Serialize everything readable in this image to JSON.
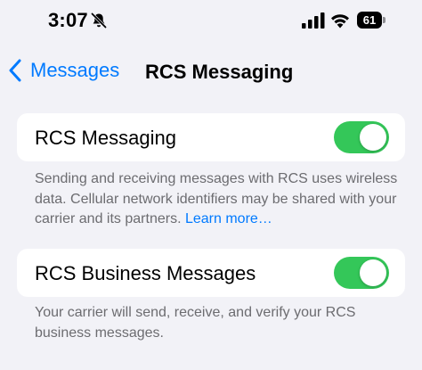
{
  "status_bar": {
    "time": "3:07",
    "battery_level": "61",
    "icons": [
      "bell-slash-icon",
      "cellular-signal-icon",
      "wifi-icon",
      "battery-icon"
    ]
  },
  "nav": {
    "back_label": "Messages",
    "title": "RCS Messaging"
  },
  "settings": [
    {
      "label": "RCS Messaging",
      "enabled": true,
      "description": "Sending and receiving messages with RCS uses wireless data. Cellular network identifiers may be shared with your carrier and its partners.",
      "link_text": "Learn more…"
    },
    {
      "label": "RCS Business Messages",
      "enabled": true,
      "description": "Your carrier will send, receive, and verify your RCS business messages."
    }
  ],
  "colors": {
    "accent": "#007aff",
    "toggle_on": "#34c759",
    "background": "#f2f2f7",
    "footer_text": "#6c6c70"
  }
}
